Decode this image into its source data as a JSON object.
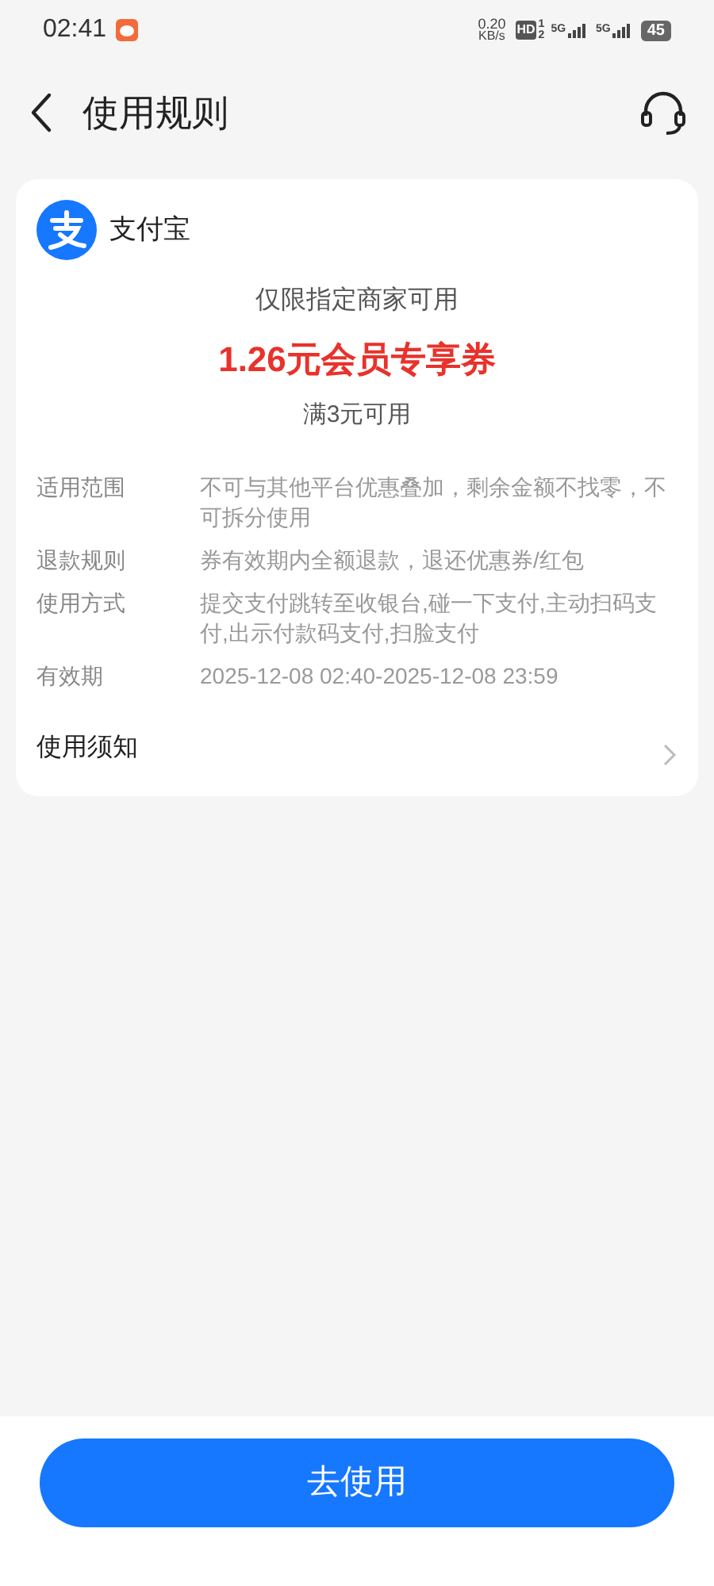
{
  "status_bar": {
    "time": "02:41",
    "speed_value": "0.20",
    "speed_unit": "KB/s",
    "hd": "HD",
    "sim_slots": [
      "1",
      "2"
    ],
    "networks": [
      "5G",
      "5G"
    ],
    "battery": "45"
  },
  "header": {
    "title": "使用规则"
  },
  "card": {
    "brand": "支付宝",
    "scope_note": "仅限指定商家可用",
    "coupon_title": "1.26元会员专享券",
    "threshold": "满3元可用",
    "details": [
      {
        "label": "适用范围",
        "value": "不可与其他平台优惠叠加，剩余金额不找零，不可拆分使用"
      },
      {
        "label": "退款规则",
        "value": "券有效期内全额退款，退还优惠券/红包"
      },
      {
        "label": "使用方式",
        "value": "提交支付跳转至收银台,碰一下支付,主动扫码支付,出示付款码支付,扫脸支付"
      },
      {
        "label": "有效期",
        "value": "2025-12-08 02:40-2025-12-08 23:59"
      }
    ],
    "notice": "使用须知"
  },
  "action_button": "去使用"
}
